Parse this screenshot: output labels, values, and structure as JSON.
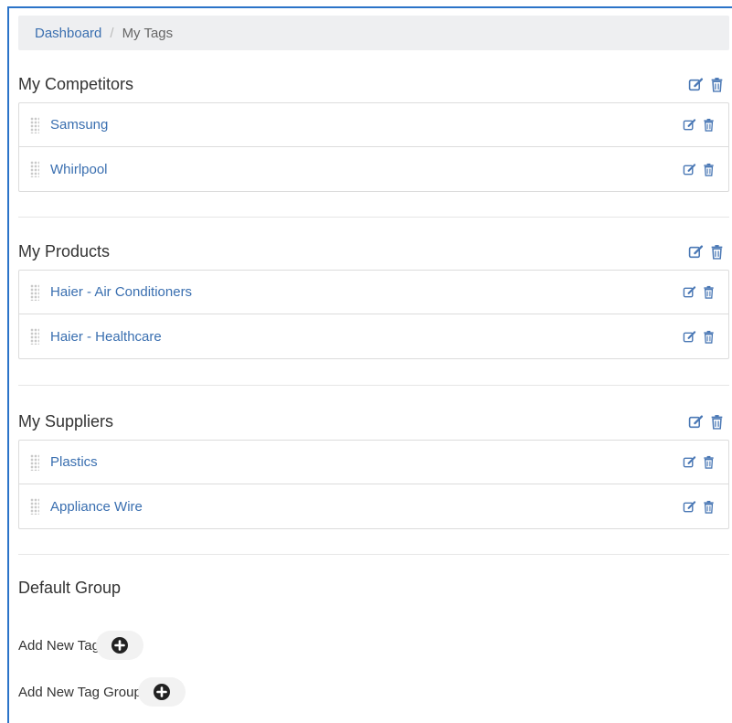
{
  "breadcrumb": {
    "home": "Dashboard",
    "separator": "/",
    "current": "My Tags"
  },
  "colors": {
    "accent": "#2b73c8",
    "link": "#3a6fb0",
    "icon": "#4a78b5",
    "border": "#dcdcdc"
  },
  "groups": [
    {
      "title": "My Competitors",
      "items": [
        {
          "label": "Samsung"
        },
        {
          "label": "Whirlpool"
        }
      ]
    },
    {
      "title": "My Products",
      "items": [
        {
          "label": "Haier - Air Conditioners"
        },
        {
          "label": "Haier - Healthcare"
        }
      ]
    },
    {
      "title": "My Suppliers",
      "items": [
        {
          "label": "Plastics"
        },
        {
          "label": "Appliance Wire"
        }
      ]
    }
  ],
  "default_group": {
    "title": "Default Group"
  },
  "add_tag_label": "Add New Tag",
  "add_group_label": "Add New Tag Group",
  "icons": {
    "edit": "edit-icon",
    "delete": "trash-icon",
    "drag": "drag-handle-icon",
    "add": "plus-circle-icon"
  }
}
